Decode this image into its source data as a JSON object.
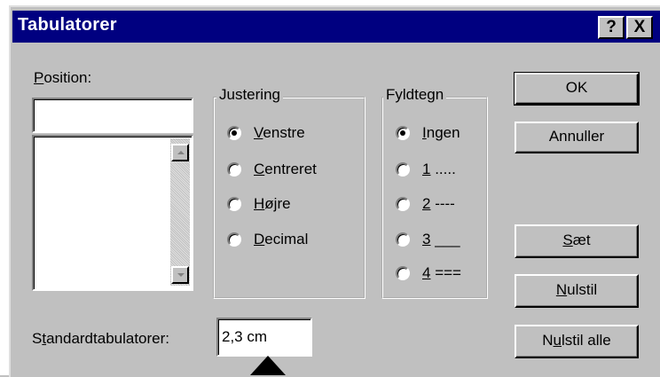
{
  "window": {
    "title": "Tabulatorer",
    "help_label": "?",
    "close_label": "X"
  },
  "position": {
    "label_first": "P",
    "label_rest": "osition:",
    "value": ""
  },
  "justering": {
    "legend": "Justering",
    "options": [
      {
        "u": "V",
        "rest": "enstre",
        "checked": true
      },
      {
        "u": "C",
        "rest": "entreret",
        "checked": false
      },
      {
        "u": "H",
        "rest": "øjre",
        "checked": false
      },
      {
        "u": "D",
        "rest": "ecimal",
        "checked": false
      }
    ]
  },
  "fyldtegn": {
    "legend": "Fyldtegn",
    "options": [
      {
        "u": "I",
        "rest": "ngen",
        "checked": true
      },
      {
        "u": "1",
        "rest": " .....",
        "checked": false
      },
      {
        "u": "2",
        "rest": " ----",
        "checked": false
      },
      {
        "u": "3",
        "rest": " ___",
        "checked": false
      },
      {
        "u": "4",
        "rest": " ===",
        "checked": false
      }
    ]
  },
  "buttons": {
    "ok": "OK",
    "cancel": "Annuller",
    "set_u": "S",
    "set_rest": "æt",
    "clear_u": "N",
    "clear_rest": "ulstil",
    "clear_all_pre": "N",
    "clear_all_u": "u",
    "clear_all_rest": "lstil alle"
  },
  "standard": {
    "label_pre": "S",
    "label_u": "t",
    "label_rest": "andardtabulatorer:",
    "value": "2,3 cm"
  },
  "colors": {
    "titlebar": "#000080",
    "face": "#c0c0c0"
  },
  "icons": {
    "pointer": "black-up-triangle"
  }
}
